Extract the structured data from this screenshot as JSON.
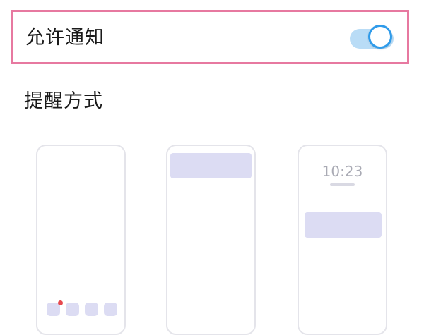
{
  "notifications": {
    "allow_label": "允许通知",
    "allow_enabled": true,
    "highlight_color": "#e779a0",
    "toggle_on_color": "#2f9bea"
  },
  "reminder": {
    "title": "提醒方式",
    "options": [
      {
        "icon": "home-screen-badge-preview"
      },
      {
        "icon": "banner-preview"
      },
      {
        "icon": "lock-screen-preview",
        "time": "10:23"
      }
    ]
  }
}
